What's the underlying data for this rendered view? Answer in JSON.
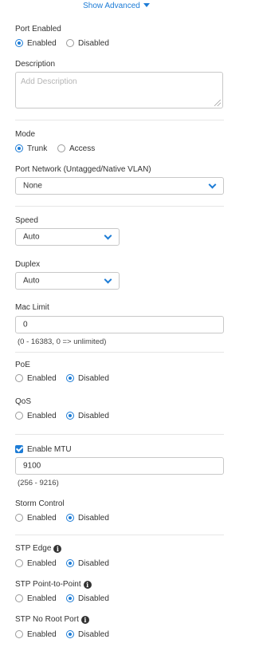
{
  "show_advanced": "Show Advanced",
  "port_enabled": {
    "label": "Port Enabled",
    "options": [
      "Enabled",
      "Disabled"
    ],
    "selected": "Enabled"
  },
  "description": {
    "label": "Description",
    "placeholder": "Add Description",
    "value": ""
  },
  "mode": {
    "label": "Mode",
    "options": [
      "Trunk",
      "Access"
    ],
    "selected": "Trunk"
  },
  "port_network": {
    "label": "Port Network (Untagged/Native VLAN)",
    "value": "None"
  },
  "speed": {
    "label": "Speed",
    "value": "Auto"
  },
  "duplex": {
    "label": "Duplex",
    "value": "Auto"
  },
  "mac_limit": {
    "label": "Mac Limit",
    "value": "0",
    "hint": "(0 - 16383, 0 => unlimited)"
  },
  "poe": {
    "label": "PoE",
    "options": [
      "Enabled",
      "Disabled"
    ],
    "selected": "Disabled"
  },
  "qos": {
    "label": "QoS",
    "options": [
      "Enabled",
      "Disabled"
    ],
    "selected": "Disabled"
  },
  "mtu": {
    "label": "Enable MTU",
    "checked": true,
    "value": "9100",
    "hint": "(256 - 9216)"
  },
  "storm_control": {
    "label": "Storm Control",
    "options": [
      "Enabled",
      "Disabled"
    ],
    "selected": "Disabled"
  },
  "stp_edge": {
    "label": "STP Edge",
    "options": [
      "Enabled",
      "Disabled"
    ],
    "selected": "Disabled"
  },
  "stp_p2p": {
    "label": "STP Point-to-Point",
    "options": [
      "Enabled",
      "Disabled"
    ],
    "selected": "Disabled"
  },
  "stp_no_root": {
    "label": "STP No Root Port",
    "options": [
      "Enabled",
      "Disabled"
    ],
    "selected": "Disabled"
  },
  "colors": {
    "accent": "#1d7cd6",
    "border": "#c8c8c8",
    "text": "#333333"
  },
  "icons": [
    "chevron-down-icon",
    "info-icon",
    "checkbox-check-icon",
    "resize-grip-icon"
  ]
}
